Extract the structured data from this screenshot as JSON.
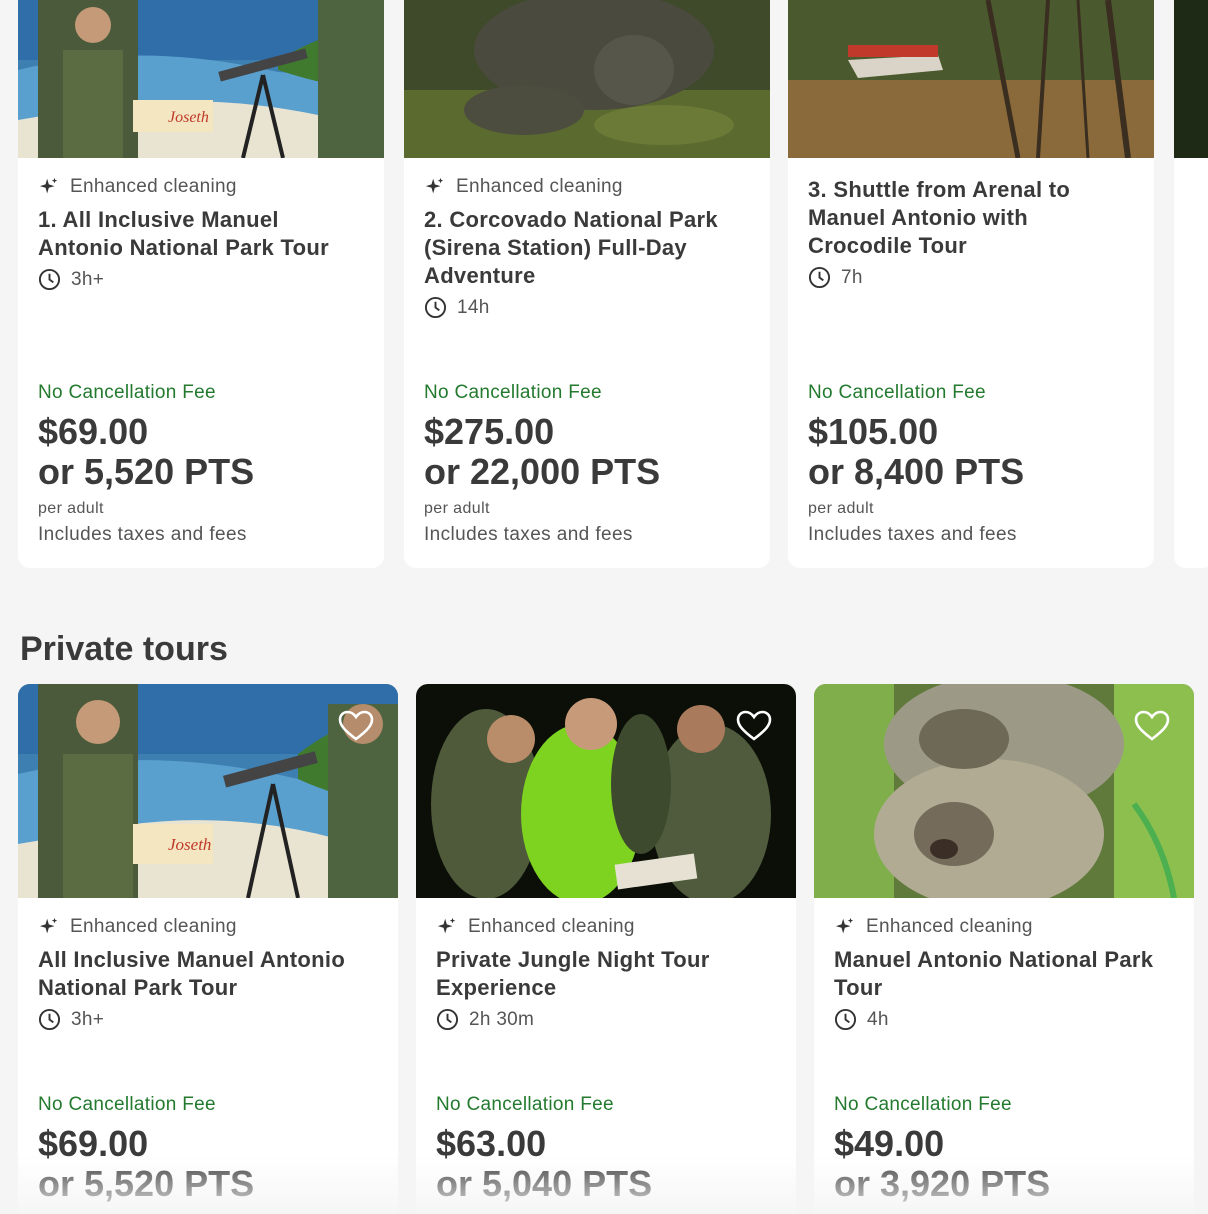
{
  "common": {
    "enhanced": "Enhanced cleaning",
    "no_cancel": "No Cancellation Fee",
    "per_adult": "per adult",
    "taxes": "Includes taxes and fees"
  },
  "top_cards": [
    {
      "title": "1. All Inclusive Manuel Antonio National Park Tour",
      "duration": "3h+",
      "price": "$69.00",
      "pts": "or 5,520 PTS"
    },
    {
      "title": "2. Corcovado National Park (Sirena Station) Full-Day Adventure",
      "duration": "14h",
      "price": "$275.00",
      "pts": "or 22,000 PTS"
    },
    {
      "title": "3. Shuttle from Arenal to Manuel Antonio with Crocodile Tour",
      "duration": "7h",
      "price": "$105.00",
      "pts": "or 8,400 PTS"
    }
  ],
  "section": {
    "title": "Private tours"
  },
  "private_cards": [
    {
      "title": "All Inclusive Manuel Antonio National Park Tour",
      "duration": "3h+",
      "price": "$69.00",
      "pts": "or 5,520 PTS"
    },
    {
      "title": "Private Jungle Night Tour Experience",
      "duration": "2h 30m",
      "price": "$63.00",
      "pts": "or 5,040 PTS"
    },
    {
      "title": "Manuel Antonio National Park Tour",
      "duration": "4h",
      "price": "$49.00",
      "pts": "or 3,920 PTS"
    }
  ],
  "colors": {
    "green": "#237a2e",
    "text": "#3a3a3a",
    "bg": "#f5f5f5"
  },
  "icons": [
    "sparkle-icon",
    "clock-icon",
    "heart-icon"
  ]
}
